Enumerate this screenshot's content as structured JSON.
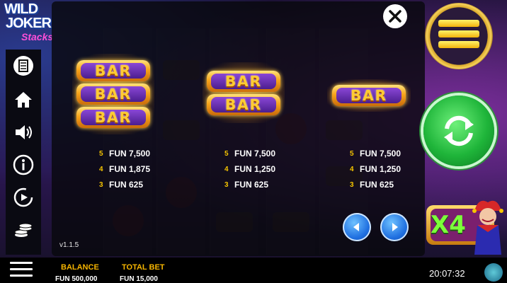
{
  "game": {
    "logo_line1": "WILD",
    "logo_line2": "JOKER",
    "logo_line3": "Stacks",
    "version": "v1.1.5"
  },
  "paytable": {
    "symbol_label": "BAR",
    "groups": [
      {
        "symbol": "triple-bar",
        "tiles": [
          "BAR",
          "BAR",
          "BAR"
        ],
        "payouts": [
          {
            "count": "5",
            "value": "FUN 7,500"
          },
          {
            "count": "4",
            "value": "FUN 1,875"
          },
          {
            "count": "3",
            "value": "FUN 625"
          }
        ]
      },
      {
        "symbol": "double-bar",
        "tiles": [
          "BAR",
          "BAR"
        ],
        "payouts": [
          {
            "count": "5",
            "value": "FUN 7,500"
          },
          {
            "count": "4",
            "value": "FUN 1,250"
          },
          {
            "count": "3",
            "value": "FUN 625"
          }
        ]
      },
      {
        "symbol": "single-bar",
        "tiles": [
          "BAR"
        ],
        "payouts": [
          {
            "count": "5",
            "value": "FUN 7,500"
          },
          {
            "count": "4",
            "value": "FUN 1,250"
          },
          {
            "count": "3",
            "value": "FUN 625"
          }
        ]
      }
    ]
  },
  "sidebar": {
    "items": [
      {
        "icon": "paytable-icon"
      },
      {
        "icon": "home-icon"
      },
      {
        "icon": "sound-icon"
      },
      {
        "icon": "info-icon"
      },
      {
        "icon": "autoplay-icon"
      },
      {
        "icon": "coins-icon"
      }
    ]
  },
  "multiplier": {
    "label": "X4"
  },
  "footer": {
    "balance_label": "BALANCE",
    "balance_value": "FUN 500,000",
    "total_bet_label": "TOTAL BET",
    "total_bet_value": "FUN 15,000",
    "clock": "20:07:32"
  },
  "colors": {
    "gold": "#f5b400",
    "payout_count": "#f5c400",
    "spin_green": "#1fb53a",
    "nav_blue": "#1f6fe0",
    "multiplier_green": "#7cff3a"
  }
}
